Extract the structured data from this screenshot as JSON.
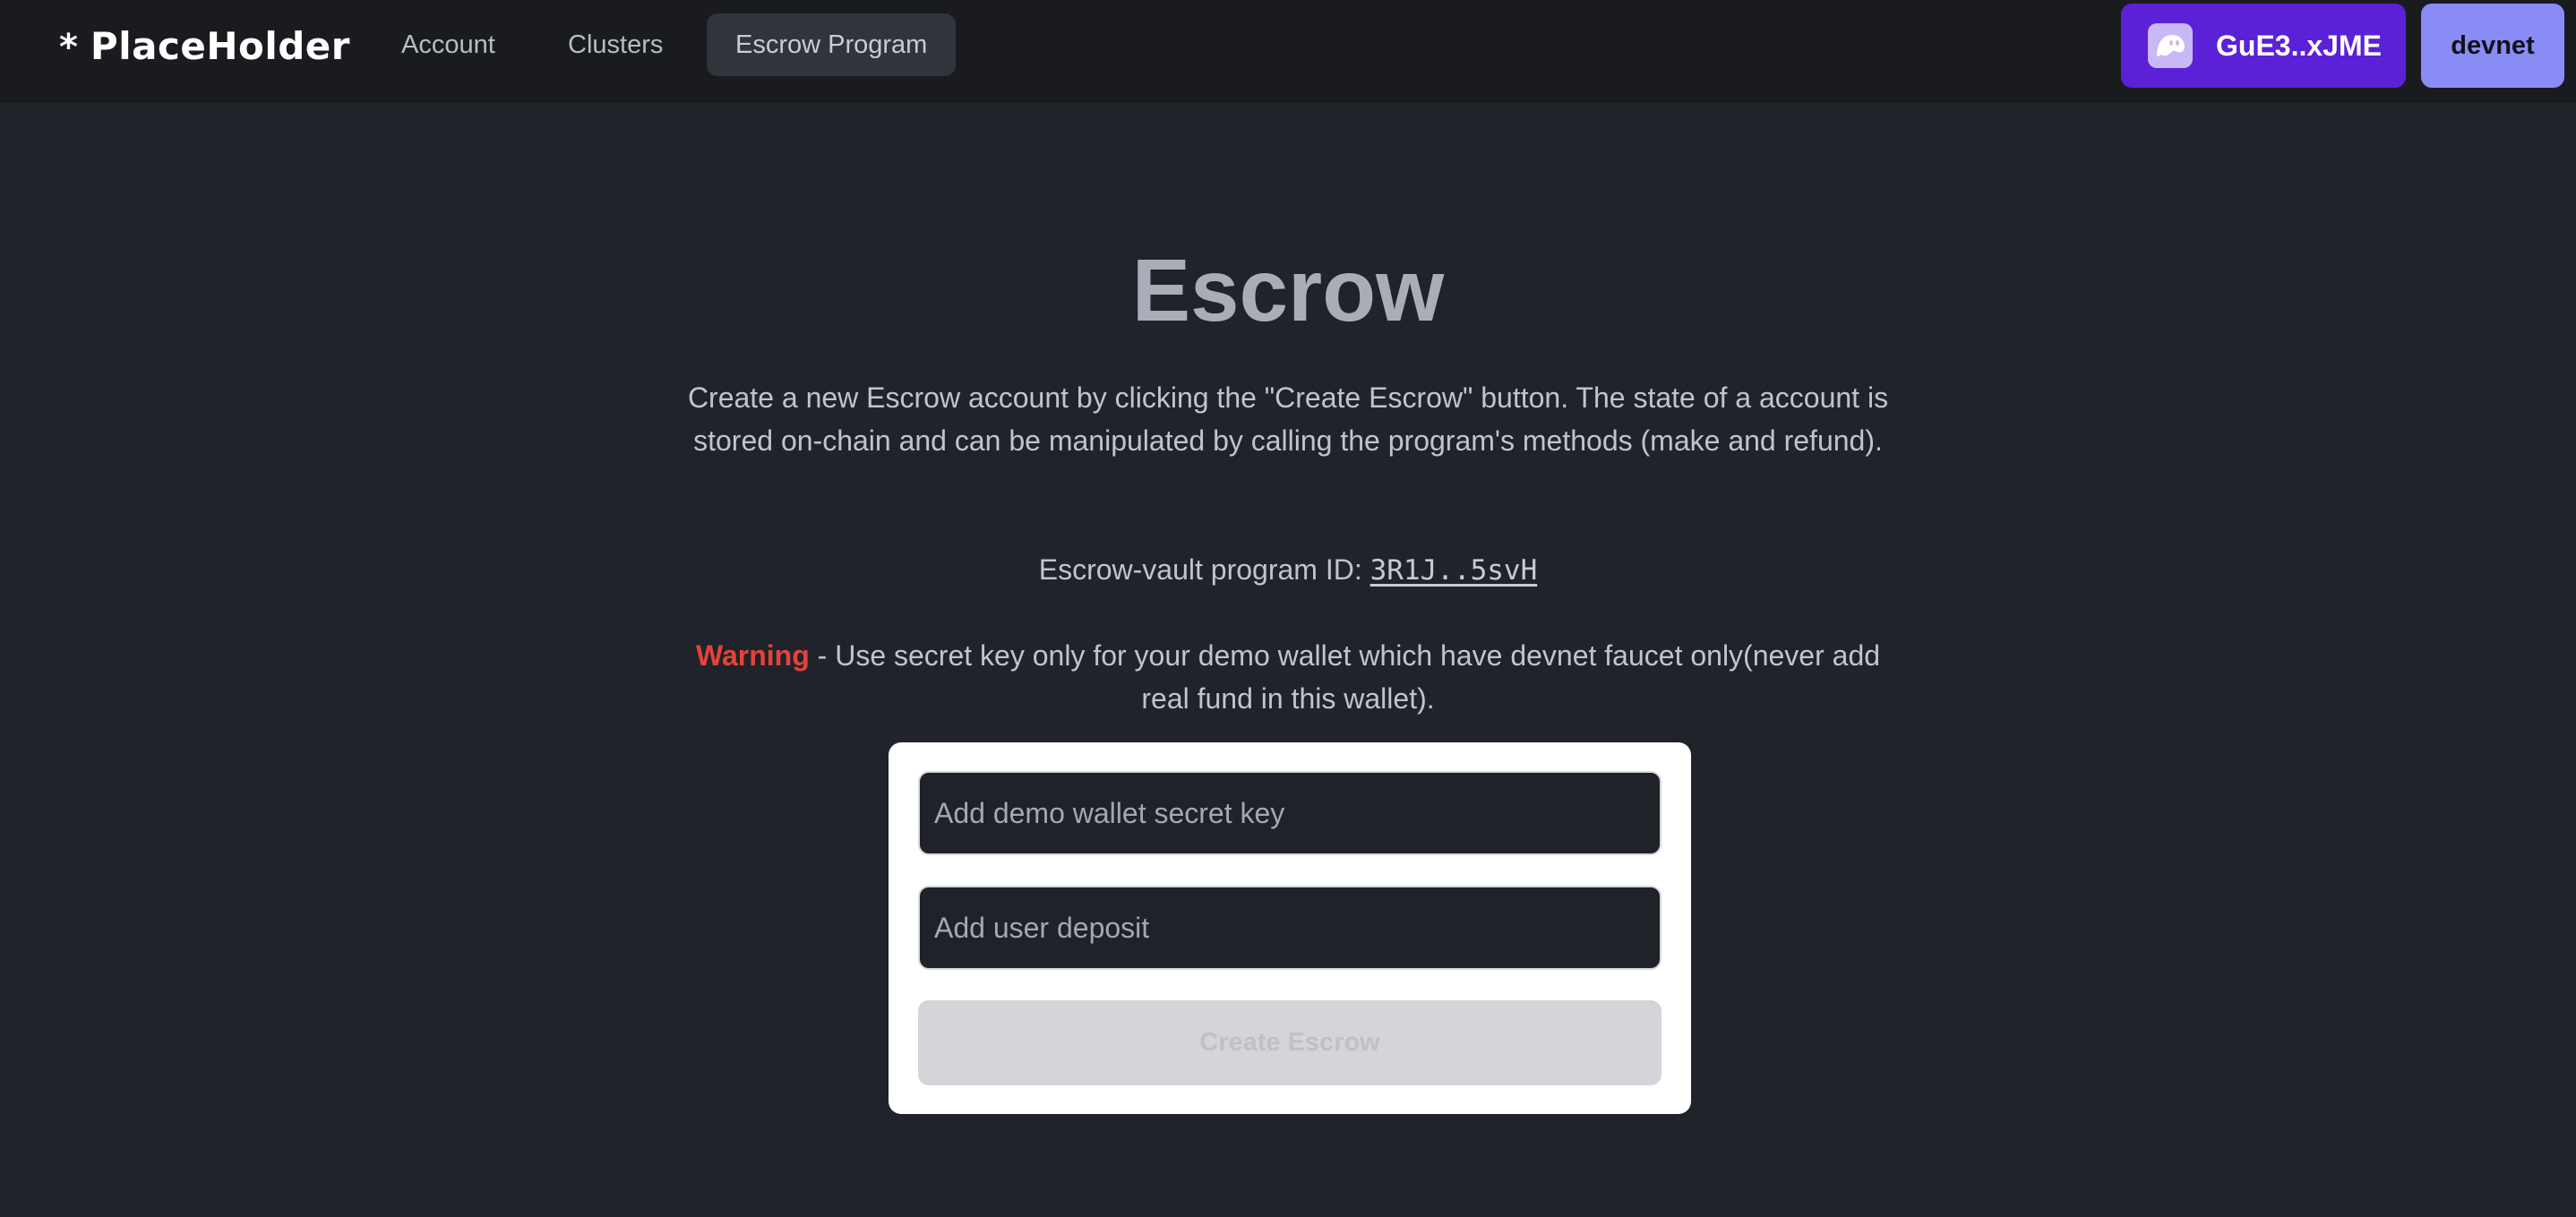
{
  "navbar": {
    "brand": {
      "star": "*",
      "name": "PlaceHolder"
    },
    "links": [
      {
        "label": "Account",
        "active": false
      },
      {
        "label": "Clusters",
        "active": false
      },
      {
        "label": "Escrow Program",
        "active": true
      }
    ],
    "wallet": {
      "label": "GuE3..xJME",
      "icon": "phantom-ghost-icon",
      "color": "#5b21d6"
    },
    "cluster": {
      "label": "devnet",
      "color": "#8a8cf6"
    }
  },
  "hero": {
    "title": "Escrow",
    "description": "Create a new Escrow account by clicking the \"Create Escrow\" button. The state of a account is stored on-chain and can be manipulated by calling the program's methods (make and refund).",
    "program_label": "Escrow-vault program ID: ",
    "program_id": "3R1J..5svH",
    "warning_word": "Warning",
    "warning_text": " - Use secret key only for your demo wallet which have devnet faucet only(never add real fund in this wallet)."
  },
  "form": {
    "secret_key": {
      "value": "",
      "placeholder": "Add demo wallet secret key"
    },
    "deposit": {
      "value": "",
      "placeholder": "Add user deposit"
    },
    "submit_label": "Create Escrow",
    "submit_disabled": true
  },
  "colors": {
    "page_background": "#20232a",
    "navbar_background": "#191b1f",
    "warning": "#e5433a",
    "card_background": "#ffffff"
  }
}
